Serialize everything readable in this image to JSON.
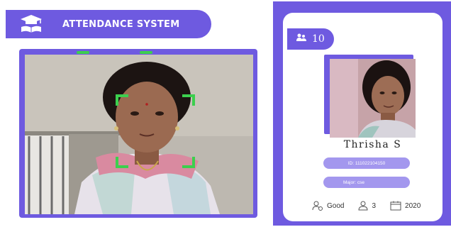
{
  "header": {
    "title": "ATTENDANCE SYSTEM",
    "logo_icon": "graduation-cap-book-icon"
  },
  "colors": {
    "accent": "#6e5ae0",
    "accent_light": "#a397ee",
    "face_box": "#3ccf4e",
    "card_bg": "#ffffff"
  },
  "camera": {
    "face_box_icon": "face-detection-box"
  },
  "student_card": {
    "count": "10",
    "count_icon": "attendees-icon",
    "name": "Thrisha S",
    "id_text": "ID: 111022104150",
    "major_text": "Major: cse",
    "standing": "Good",
    "standing_icon": "user-check-icon",
    "year_level": "3",
    "year_level_icon": "user-icon",
    "year": "2020",
    "year_icon": "calendar-icon"
  }
}
